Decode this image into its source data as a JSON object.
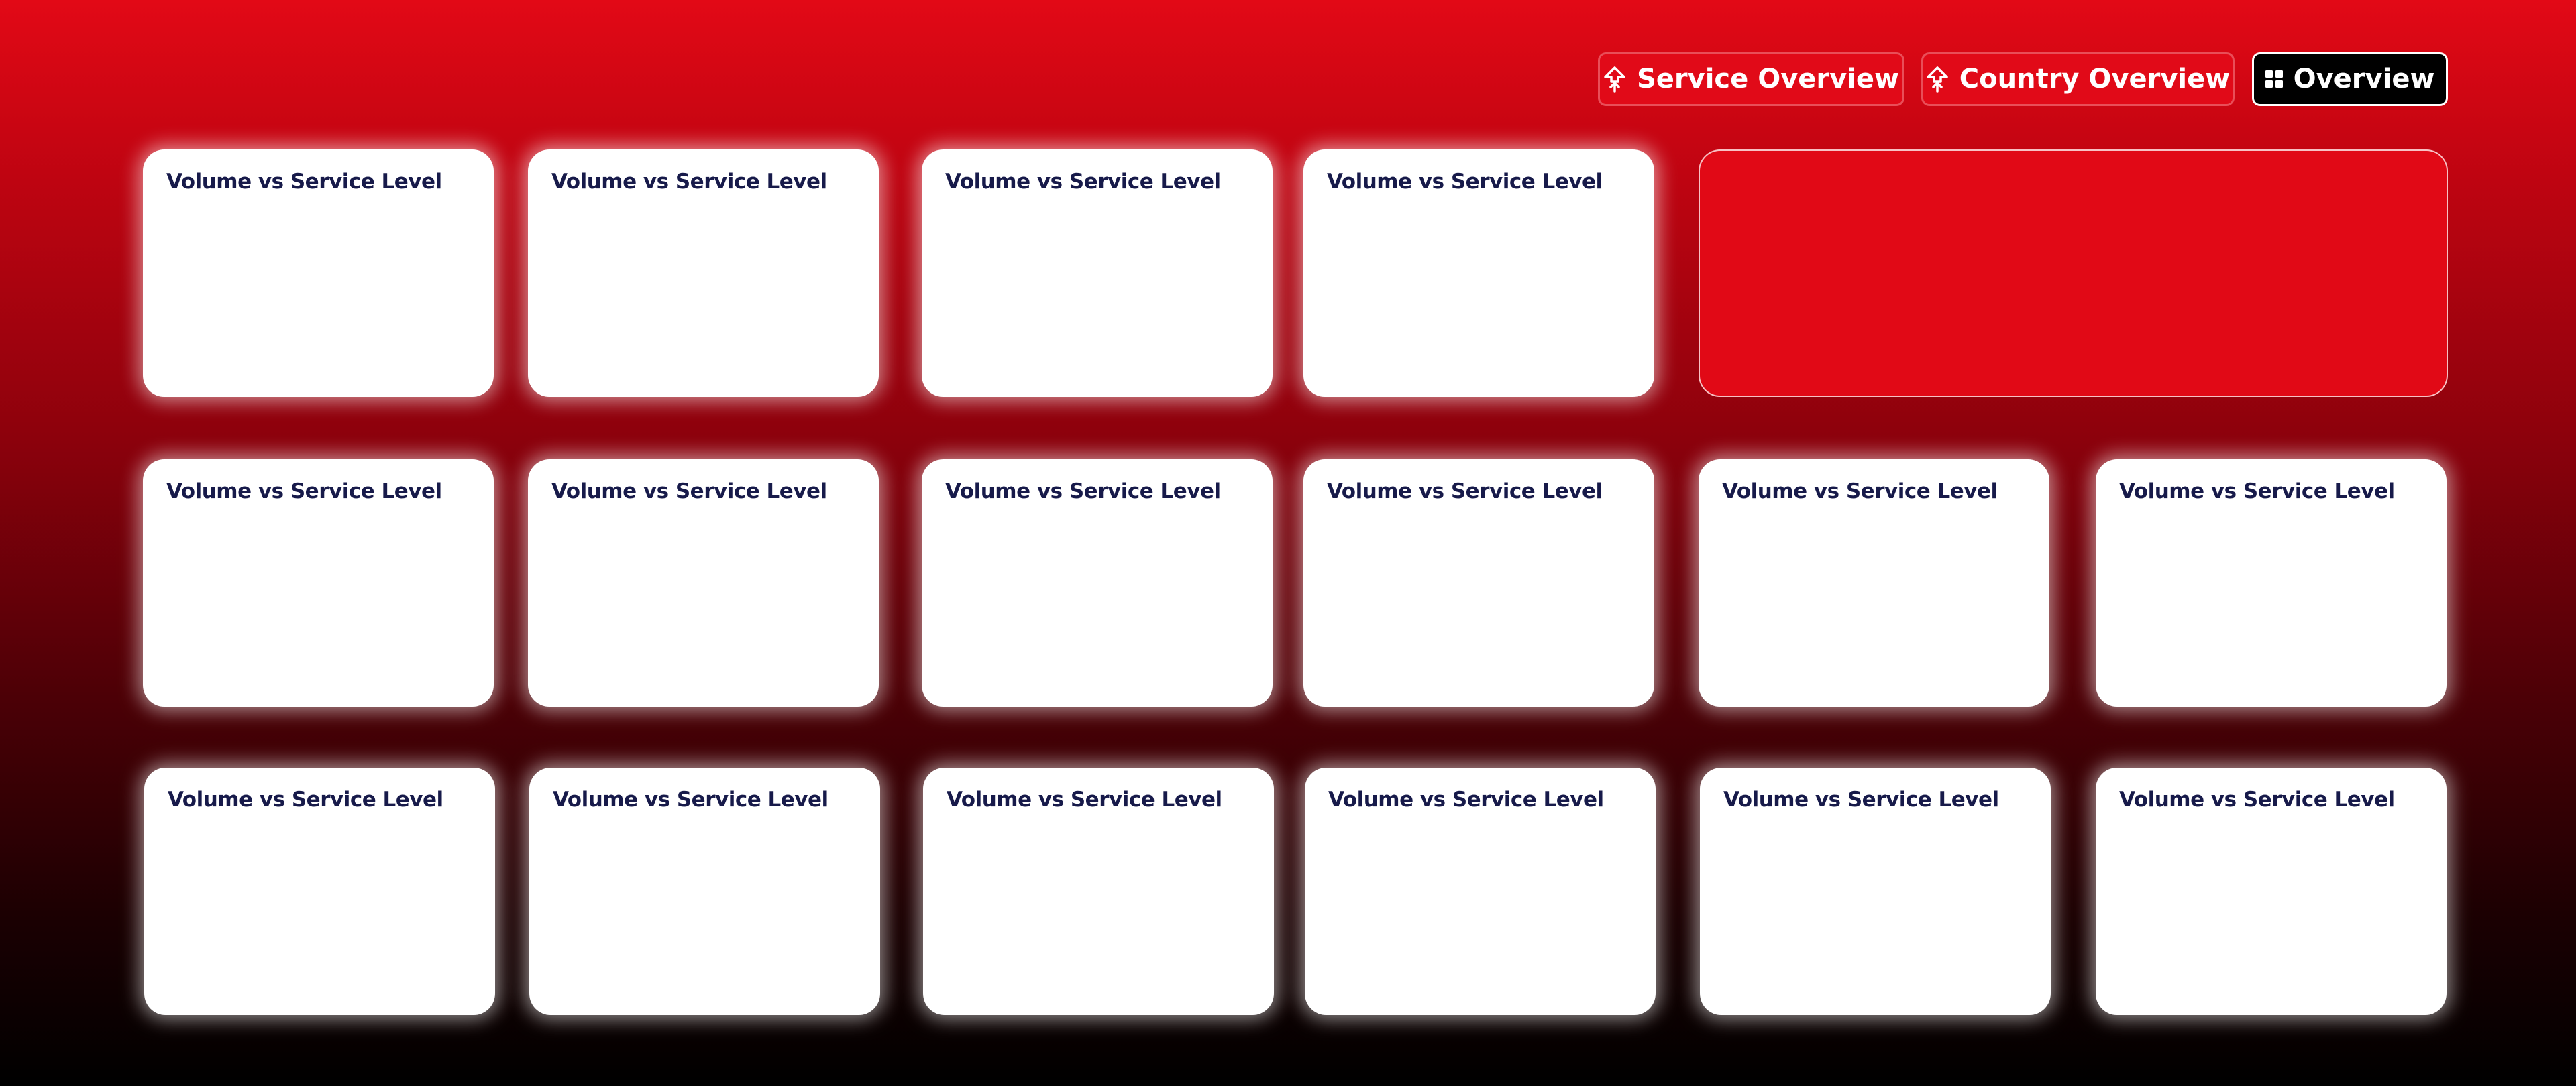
{
  "nav": {
    "buttons": [
      {
        "label": "Service Overview",
        "icon": "upload-icon",
        "active": false
      },
      {
        "label": "Country Overview",
        "icon": "upload-icon",
        "active": false
      },
      {
        "label": "Overview",
        "icon": "grid-icon",
        "active": true
      }
    ]
  },
  "cards": [
    {
      "title": "Volume vs Service Level"
    },
    {
      "title": "Volume vs Service Level"
    },
    {
      "title": "Volume vs Service Level"
    },
    {
      "title": "Volume vs Service Level"
    },
    {
      "title": "Volume vs Service Level"
    },
    {
      "title": "Volume vs Service Level"
    },
    {
      "title": "Volume vs Service Level"
    },
    {
      "title": "Volume vs Service Level"
    },
    {
      "title": "Volume vs Service Level"
    },
    {
      "title": "Volume vs Service Level"
    },
    {
      "title": "Volume vs Service Level"
    },
    {
      "title": "Volume vs Service Level"
    },
    {
      "title": "Volume vs Service Level"
    },
    {
      "title": "Volume vs Service Level"
    },
    {
      "title": "Volume vs Service Level"
    },
    {
      "title": "Volume vs Service Level"
    }
  ],
  "colors": {
    "background_top": "#e20916",
    "background_bottom": "#000000",
    "accent_red": "#e10a18",
    "card_title": "#171a4a",
    "card_background": "#ffffff"
  }
}
